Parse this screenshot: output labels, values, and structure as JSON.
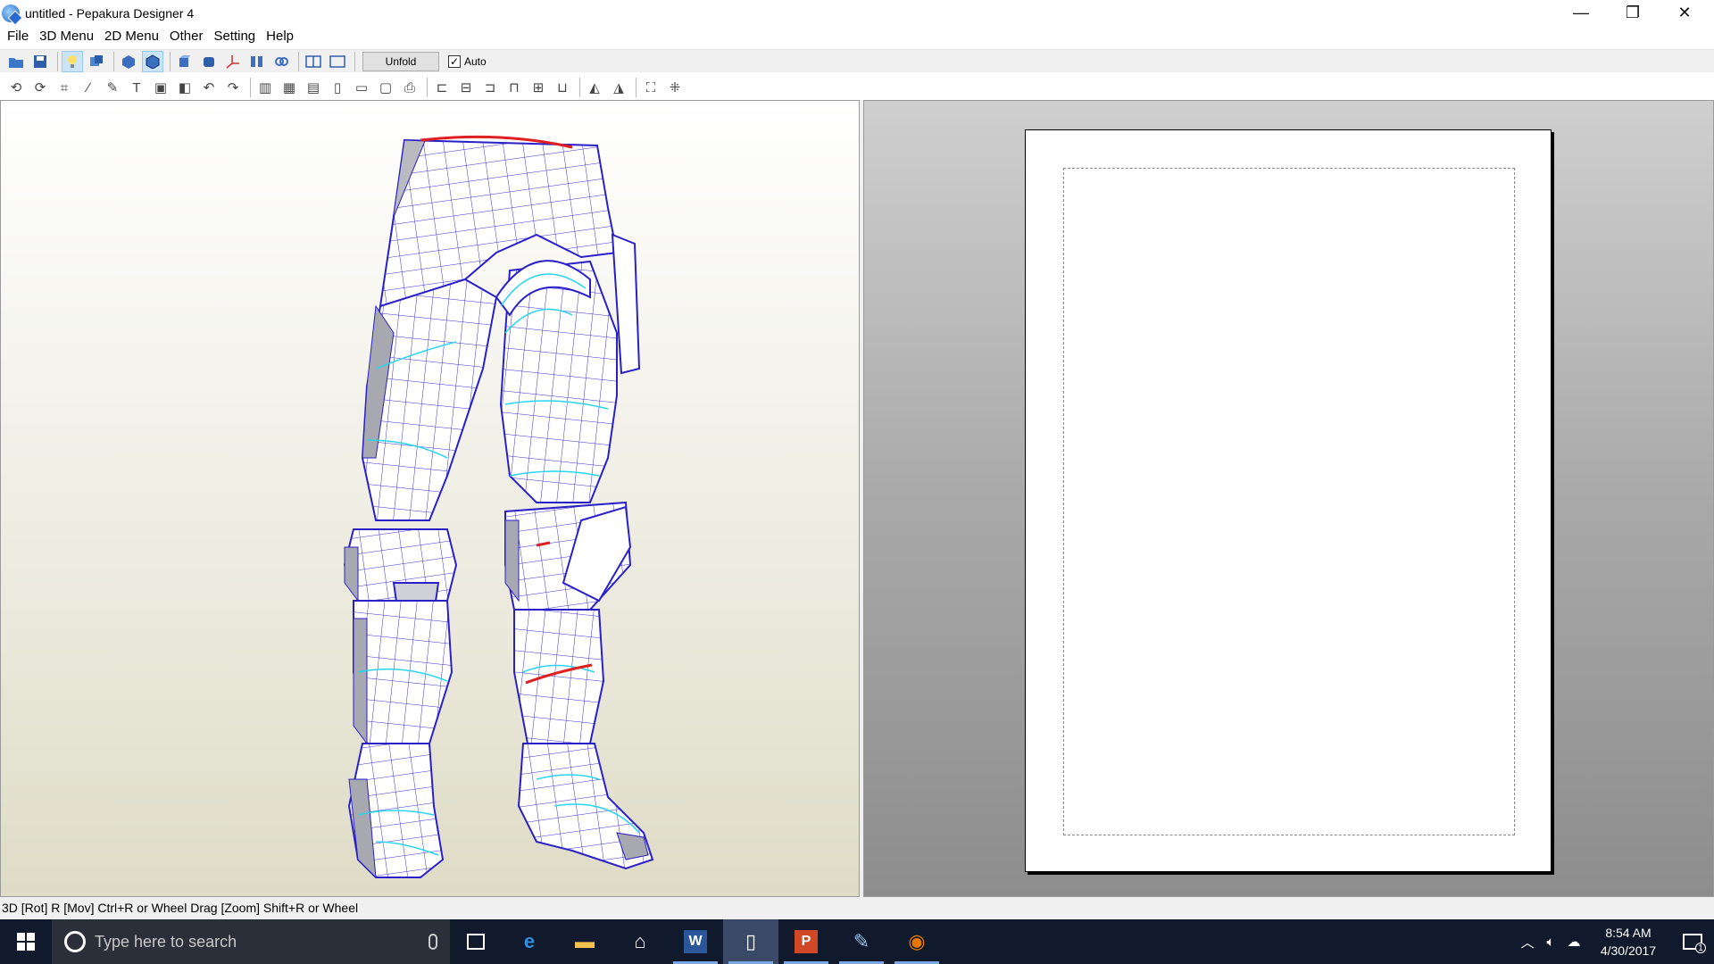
{
  "window": {
    "title": "untitled - Pepakura Designer 4",
    "controls": {
      "minimize": "—",
      "maximize": "❐",
      "close": "✕"
    }
  },
  "menu": {
    "items": [
      "File",
      "3D Menu",
      "2D Menu",
      "Other",
      "Setting",
      "Help"
    ]
  },
  "toolbar1": {
    "icons": [
      "open-icon",
      "save-icon",
      "light-icon",
      "texture-icon",
      "view-3d-icon",
      "view-3d-edges-icon",
      "cube-icon",
      "cylinder-icon",
      "axis-icon",
      "split-icon",
      "link-icon",
      "layout-split-icon",
      "layout-single-icon"
    ],
    "unfold_label": "Unfold",
    "auto_label": "Auto",
    "auto_checked": true
  },
  "toolbar2": {
    "icons": [
      "rotate-icon",
      "rotate-parts-icon",
      "join-icon",
      "draw-icon",
      "pen-icon",
      "text-icon",
      "image-icon",
      "box-icon",
      "undo-icon",
      "redo-icon",
      "book-icon",
      "grid-icon",
      "pages-icon",
      "page-add-icon",
      "page-next-icon",
      "clipboard-icon",
      "print-icon",
      "align-left-icon",
      "align-center-icon",
      "align-right-icon",
      "align-top-icon",
      "align-middle-icon",
      "align-bottom-icon",
      "flip-h-icon",
      "flip-v-icon",
      "fit-icon",
      "arrange-icon"
    ]
  },
  "status": {
    "text": "3D [Rot] R [Mov] Ctrl+R or Wheel Drag [Zoom] Shift+R or Wheel"
  },
  "taskbar": {
    "search_placeholder": "Type here to search",
    "apps": [
      {
        "name": "edge",
        "glyph": "e",
        "color": "#2f8fe0",
        "running": false
      },
      {
        "name": "file-explorer",
        "glyph": "▬",
        "color": "#f2c14e",
        "running": false
      },
      {
        "name": "store",
        "glyph": "⌂",
        "color": "#ffffff",
        "running": false
      },
      {
        "name": "word",
        "glyph": "W",
        "color": "#2b579a",
        "running": true
      },
      {
        "name": "notepad",
        "glyph": "▯",
        "color": "#ffffff",
        "running": true
      },
      {
        "name": "powerpoint",
        "glyph": "P",
        "color": "#d24726",
        "running": true
      },
      {
        "name": "pepakura",
        "glyph": "✎",
        "color": "#9ac2ea",
        "running": true
      },
      {
        "name": "blender",
        "glyph": "◉",
        "color": "#ea7600",
        "running": true
      }
    ],
    "time": "8:54 AM",
    "date": "4/30/2017",
    "notification_count": "1"
  }
}
